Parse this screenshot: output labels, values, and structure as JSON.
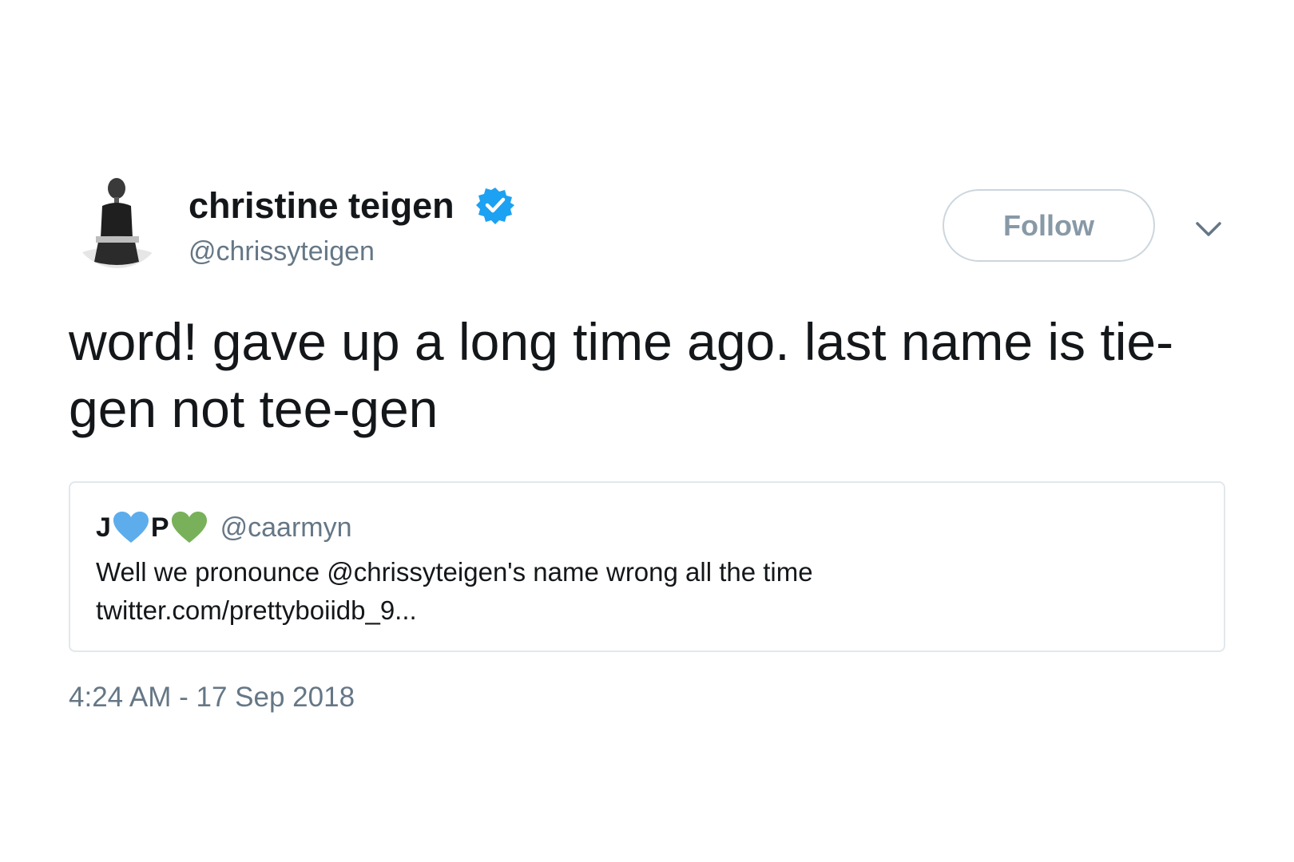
{
  "author": {
    "name": "christine teigen",
    "handle": "@chrissyteigen",
    "verified": true,
    "avatar_icon": "profile-photo"
  },
  "actions": {
    "follow_label": "Follow",
    "menu_icon": "chevron-down-icon"
  },
  "tweet": {
    "text": "word! gave up a long time ago. last name is tie-gen not tee-gen",
    "timestamp": "4:24 AM - 17 Sep 2018"
  },
  "quoted_tweet": {
    "name_parts": [
      "J",
      "P"
    ],
    "name_hearts": [
      "blue-heart-icon",
      "green-heart-icon"
    ],
    "handle": "@caarmyn",
    "text_line1": "Well we pronounce @chrissyteigen's name wrong all the time",
    "text_line2": "twitter.com/prettyboiidb_9..."
  },
  "colors": {
    "verified_blue": "#1da1f2",
    "heart_blue": "#5dadec",
    "heart_green": "#78b159",
    "secondary_text": "#657786",
    "border": "#e1e8ed"
  }
}
